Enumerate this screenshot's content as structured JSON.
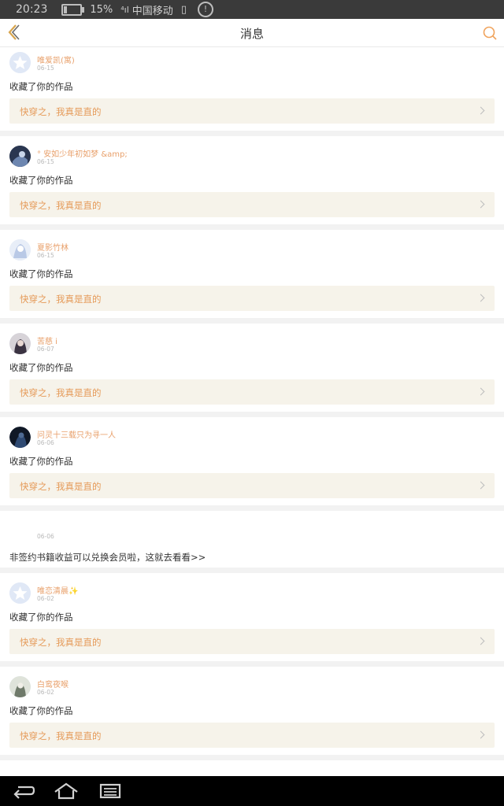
{
  "status_bar": {
    "time": "20:23",
    "battery_percent": "15%",
    "carrier": "中国移动",
    "info_icon": "!"
  },
  "header": {
    "title": "消息",
    "back_icon": "chevron-left-icon",
    "search_icon": "search-icon"
  },
  "colors": {
    "accent": "#e59a58",
    "username": "#e8a06b",
    "work_bg": "#f6f3ea"
  },
  "messages": [
    {
      "type": "favorite",
      "user": "唯爱凯(寓)",
      "date": "06-15",
      "action": "收藏了你的作品",
      "work": "快穿之，我真是直的",
      "avatar": "star-avatar"
    },
    {
      "type": "favorite",
      "user": "° 安如少年初如梦 &amp;",
      "date": "06-15",
      "action": "收藏了你的作品",
      "work": "快穿之，我真是直的",
      "avatar": "dark-avatar"
    },
    {
      "type": "favorite",
      "user": "夏影竹林",
      "date": "06-15",
      "action": "收藏了你的作品",
      "work": "快穿之，我真是直的",
      "avatar": "anime-avatar"
    },
    {
      "type": "favorite",
      "user": "苦慈 i",
      "date": "06-07",
      "action": "收藏了你的作品",
      "work": "快穿之，我真是直的",
      "avatar": "portrait-avatar"
    },
    {
      "type": "favorite",
      "user": "问灵十三载只为寻一人",
      "date": "06-06",
      "action": "收藏了你的作品",
      "work": "快穿之，我真是直的",
      "avatar": "night-avatar"
    },
    {
      "type": "notice",
      "date": "06-06",
      "text": "非签约书籍收益可以兑换会员啦，这就去看看>>"
    },
    {
      "type": "favorite",
      "user": "唯恋清晨✨",
      "date": "06-02",
      "action": "收藏了你的作品",
      "work": "快穿之，我真是直的",
      "avatar": "star-avatar"
    },
    {
      "type": "favorite",
      "user": "白鸾夜喉",
      "date": "06-02",
      "action": "收藏了你的作品",
      "work": "快穿之，我真是直的",
      "avatar": "figure-avatar"
    }
  ]
}
